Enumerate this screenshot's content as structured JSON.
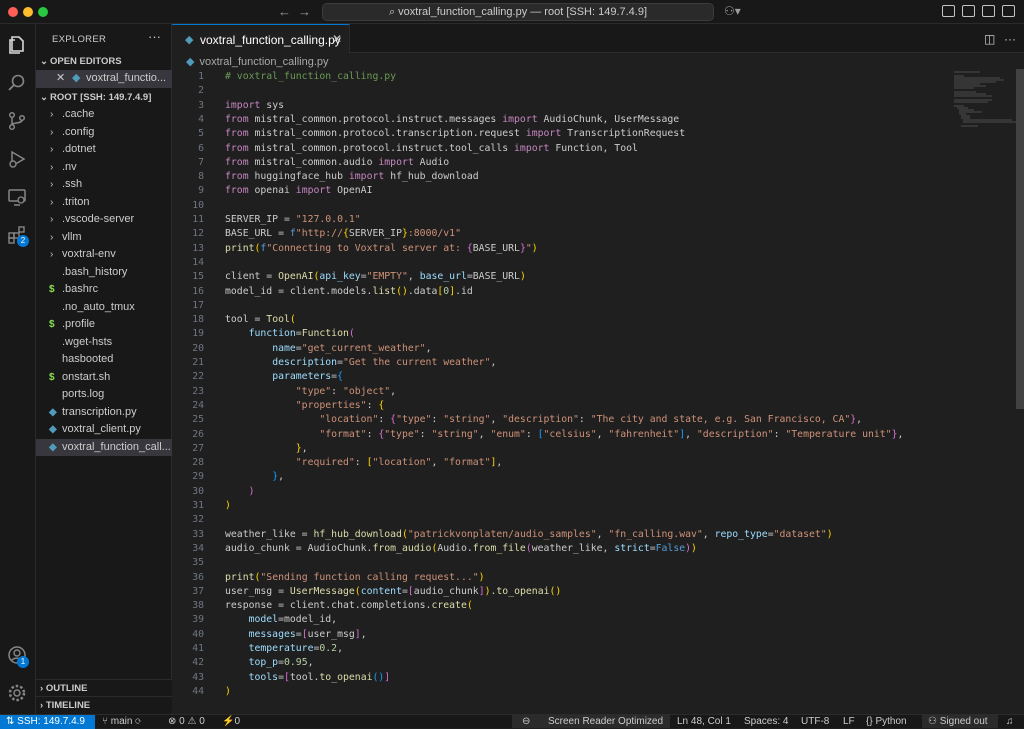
{
  "titlebar": {
    "command_center": "voxtral_function_calling.py — root [SSH: 149.7.4.9]"
  },
  "activity": {
    "extensions_badge": "2",
    "accounts_badge": "1"
  },
  "sidebar": {
    "title": "EXPLORER",
    "more": "···",
    "open_editors_label": "OPEN EDITORS",
    "open_editor_file": "voxtral_functio...",
    "root_label": "ROOT [SSH: 149.7.4.9]",
    "folders": [
      ".cache",
      ".config",
      ".dotnet",
      ".nv",
      ".ssh",
      ".triton",
      ".vscode-server",
      "vllm",
      "voxtral-env"
    ],
    "files": [
      {
        "name": ".bash_history",
        "icon": ""
      },
      {
        "name": ".bashrc",
        "icon": "$"
      },
      {
        "name": ".no_auto_tmux",
        "icon": ""
      },
      {
        "name": ".profile",
        "icon": "$"
      },
      {
        "name": ".wget-hsts",
        "icon": ""
      },
      {
        "name": "hasbooted",
        "icon": ""
      },
      {
        "name": "onstart.sh",
        "icon": "$"
      },
      {
        "name": "ports.log",
        "icon": ""
      },
      {
        "name": "transcription.py",
        "icon": "py"
      },
      {
        "name": "voxtral_client.py",
        "icon": "py"
      },
      {
        "name": "voxtral_function_call...",
        "icon": "py"
      }
    ],
    "outline_label": "OUTLINE",
    "timeline_label": "TIMELINE"
  },
  "editor": {
    "tab_label": "voxtral_function_calling.py",
    "breadcrumb": "voxtral_function_calling.py",
    "line_numbers": [
      "1",
      "2",
      "3",
      "4",
      "5",
      "6",
      "7",
      "8",
      "9",
      "10",
      "11",
      "12",
      "13",
      "14",
      "15",
      "16",
      "17",
      "18",
      "19",
      "20",
      "21",
      "22",
      "23",
      "24",
      "25",
      "26",
      "27",
      "28",
      "29",
      "30",
      "31",
      "32",
      "33",
      "34",
      "35",
      "36",
      "37",
      "38",
      "39",
      "40",
      "41",
      "42",
      "43",
      "44"
    ]
  },
  "statusbar": {
    "remote": "SSH: 149.7.4.9",
    "branch": "main",
    "problems": "⊗ 0 ⚠ 0",
    "ports": "⚡0",
    "screen_reader": "Screen Reader Optimized",
    "cursor": "Ln 48, Col 1",
    "spaces": "Spaces: 4",
    "encoding": "UTF-8",
    "eol": "LF",
    "language": "Python",
    "account": "Signed out"
  },
  "colors": {
    "accent": "#0078d4",
    "background": "#1f1f1f",
    "sidebar": "#181818"
  }
}
